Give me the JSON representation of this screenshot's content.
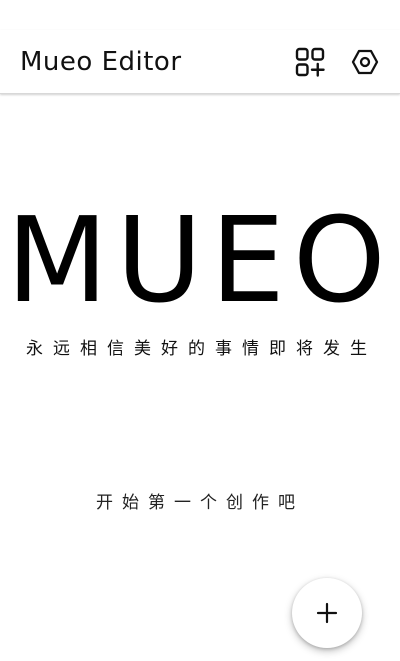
{
  "app_bar": {
    "title": "Mueo Editor",
    "actions": [
      {
        "icon": "grid-add-icon"
      },
      {
        "icon": "settings-icon"
      }
    ]
  },
  "hero": {
    "title": "MUEO",
    "slogan": "永远相信美好的事情即将发生"
  },
  "empty_state": {
    "hint": "开始第一个创作吧"
  },
  "fab": {
    "icon": "plus-icon"
  }
}
